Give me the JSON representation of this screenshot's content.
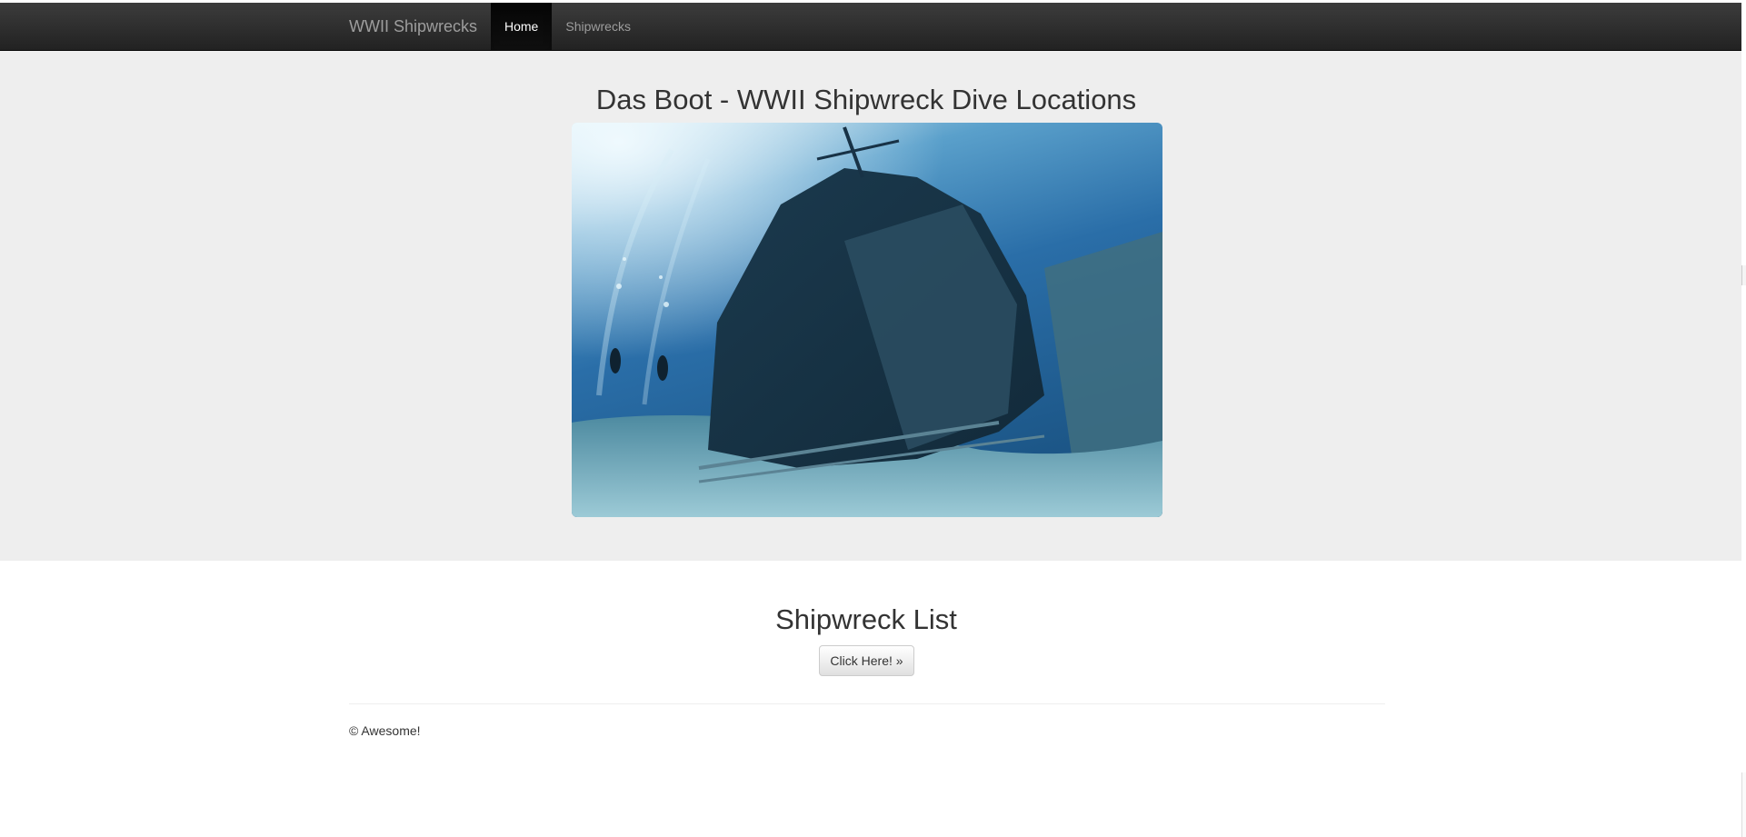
{
  "navbar": {
    "brand": "WWII Shipwrecks",
    "items": [
      {
        "label": "Home",
        "active": true
      },
      {
        "label": "Shipwrecks",
        "active": false
      }
    ]
  },
  "hero": {
    "title": "Das Boot - WWII Shipwreck Dive Locations",
    "image_subject": "Underwater photo of a sunken shipwreck on a sandy seabed with two scuba divers"
  },
  "list_section": {
    "title": "Shipwreck List",
    "button_label": "Click Here! »"
  },
  "footer": {
    "text": "© Awesome!"
  },
  "colors": {
    "navbar_bg": "#222222",
    "jumbotron_bg": "#eeeeee",
    "text": "#333333",
    "nav_inactive": "#9d9d9d"
  }
}
